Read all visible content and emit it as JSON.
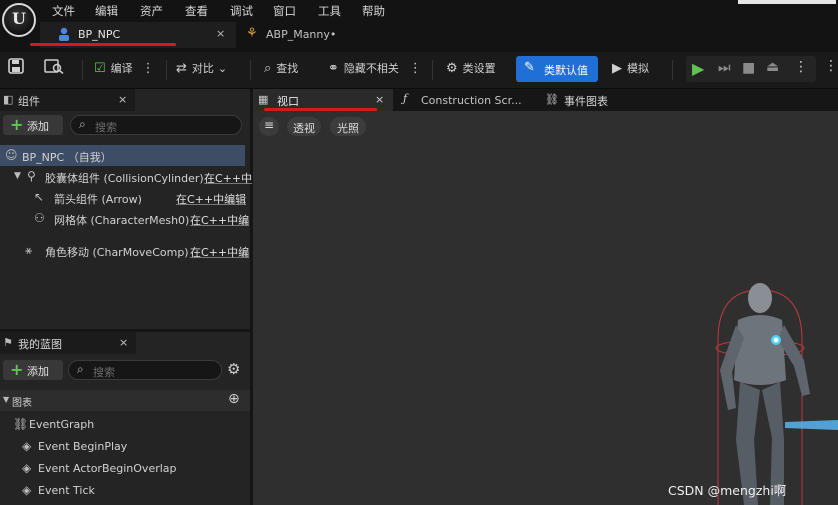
{
  "menu": [
    "文件",
    "编辑",
    "资产",
    "查看",
    "调试",
    "窗口",
    "工具",
    "帮助"
  ],
  "doc_tabs": [
    {
      "label": "BP_NPC",
      "close": "×"
    },
    {
      "label": "ABP_Manny•"
    }
  ],
  "toolbar": {
    "compile": "编译",
    "diff": "对比",
    "find": "查找",
    "hide_unrelated": "隐藏不相关",
    "class_settings": "类设置",
    "class_defaults": "类默认值",
    "simulate": "模拟"
  },
  "components_panel": {
    "title": "组件",
    "close": "×",
    "add": "添加",
    "search_placeholder": "搜索",
    "items": [
      {
        "label": "BP_NPC （自我）"
      },
      {
        "label": "胶囊体组件 (CollisionCylinder)",
        "edit": "在C++中"
      },
      {
        "label": "箭头组件 (Arrow)",
        "edit": "在C++中编辑"
      },
      {
        "label": "网格体 (CharacterMesh0)",
        "edit": "在C++中编"
      },
      {
        "label": "角色移动 (CharMoveComp)",
        "edit": "在C++中编"
      }
    ]
  },
  "blueprint_panel": {
    "title": "我的蓝图",
    "close": "×",
    "add": "添加",
    "search_placeholder": "搜索",
    "section": "图表",
    "graph": "EventGraph",
    "events": [
      "Event BeginPlay",
      "Event ActorBeginOverlap",
      "Event Tick"
    ]
  },
  "viewport_tabs": [
    {
      "label": "视口",
      "close": "×"
    },
    {
      "label": "Construction Scr..."
    },
    {
      "label": "事件图表"
    }
  ],
  "viewport": {
    "perspective": "透视",
    "lit": "光照"
  },
  "watermark": "CSDN @mengzhi啊",
  "colors": {
    "accent_blue": "#1f6fd6",
    "annotation_red": "#d21c1c",
    "add_green": "#5fc454"
  }
}
